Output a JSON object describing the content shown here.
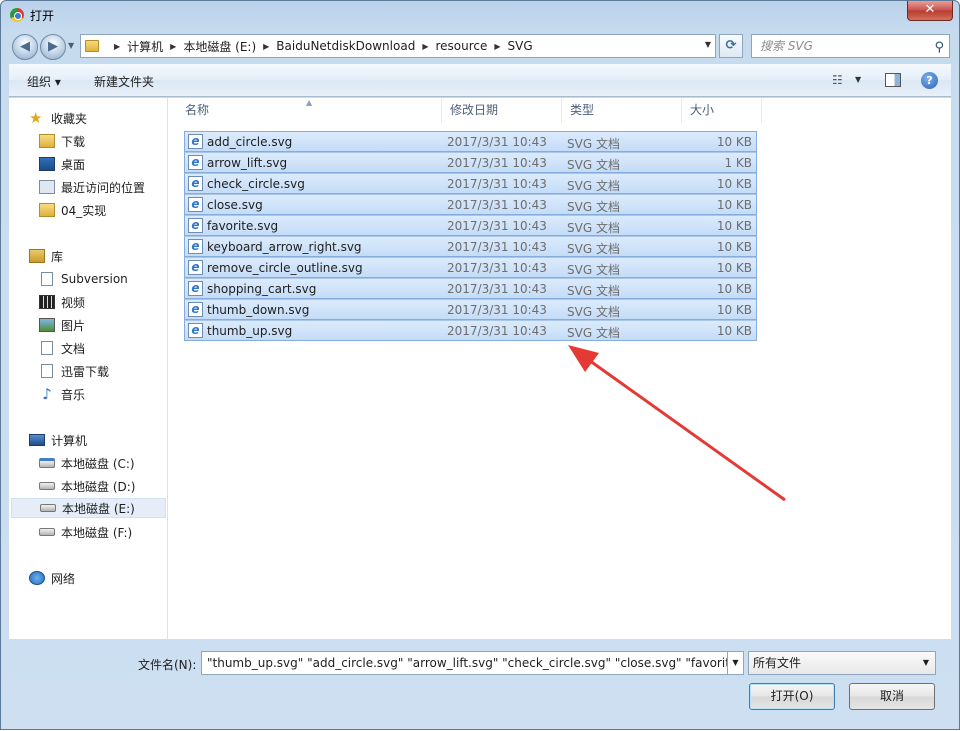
{
  "window": {
    "title": "打开",
    "close_label": "✕"
  },
  "address": {
    "crumbs": [
      "计算机",
      "本地磁盘 (E:)",
      "BaiduNetdiskDownload",
      "resource",
      "SVG"
    ],
    "search_placeholder": "搜索 SVG"
  },
  "toolbar": {
    "organize_label": "组织 ▾",
    "new_folder_label": "新建文件夹",
    "help_label": "?"
  },
  "sidebar": {
    "favorites": {
      "label": "收藏夹",
      "items": [
        "下载",
        "桌面",
        "最近访问的位置",
        "04_实现"
      ]
    },
    "libraries": {
      "label": "库",
      "items": [
        "Subversion",
        "视频",
        "图片",
        "文档",
        "迅雷下载",
        "音乐"
      ]
    },
    "computer": {
      "label": "计算机",
      "items": [
        "本地磁盘 (C:)",
        "本地磁盘 (D:)",
        "本地磁盘 (E:)",
        "本地磁盘 (F:)"
      ],
      "selected": "本地磁盘 (E:)"
    },
    "network": {
      "label": "网络"
    }
  },
  "columns": {
    "name": "名称",
    "date": "修改日期",
    "type": "类型",
    "size": "大小"
  },
  "files": [
    {
      "name": "add_circle.svg",
      "date": "2017/3/31 10:43",
      "type": "SVG 文档",
      "size": "10 KB"
    },
    {
      "name": "arrow_lift.svg",
      "date": "2017/3/31 10:43",
      "type": "SVG 文档",
      "size": "1 KB"
    },
    {
      "name": "check_circle.svg",
      "date": "2017/3/31 10:43",
      "type": "SVG 文档",
      "size": "10 KB"
    },
    {
      "name": "close.svg",
      "date": "2017/3/31 10:43",
      "type": "SVG 文档",
      "size": "10 KB"
    },
    {
      "name": "favorite.svg",
      "date": "2017/3/31 10:43",
      "type": "SVG 文档",
      "size": "10 KB"
    },
    {
      "name": "keyboard_arrow_right.svg",
      "date": "2017/3/31 10:43",
      "type": "SVG 文档",
      "size": "10 KB"
    },
    {
      "name": "remove_circle_outline.svg",
      "date": "2017/3/31 10:43",
      "type": "SVG 文档",
      "size": "10 KB"
    },
    {
      "name": "shopping_cart.svg",
      "date": "2017/3/31 10:43",
      "type": "SVG 文档",
      "size": "10 KB"
    },
    {
      "name": "thumb_down.svg",
      "date": "2017/3/31 10:43",
      "type": "SVG 文档",
      "size": "10 KB"
    },
    {
      "name": "thumb_up.svg",
      "date": "2017/3/31 10:43",
      "type": "SVG 文档",
      "size": "10 KB"
    }
  ],
  "footer": {
    "filename_label": "文件名(N):",
    "filename_value": "\"thumb_up.svg\" \"add_circle.svg\" \"arrow_lift.svg\" \"check_circle.svg\" \"close.svg\" \"favorite.svg",
    "filter_value": "所有文件",
    "open_label": "打开(O)",
    "cancel_label": "取消"
  },
  "colors": {
    "selection": "#cce0f8",
    "annotation_arrow": "#e53935"
  },
  "icons": [
    "back-icon",
    "forward-icon",
    "refresh-icon",
    "search-icon",
    "view-icon",
    "preview-pane-icon",
    "help-icon",
    "svg-file-icon"
  ]
}
